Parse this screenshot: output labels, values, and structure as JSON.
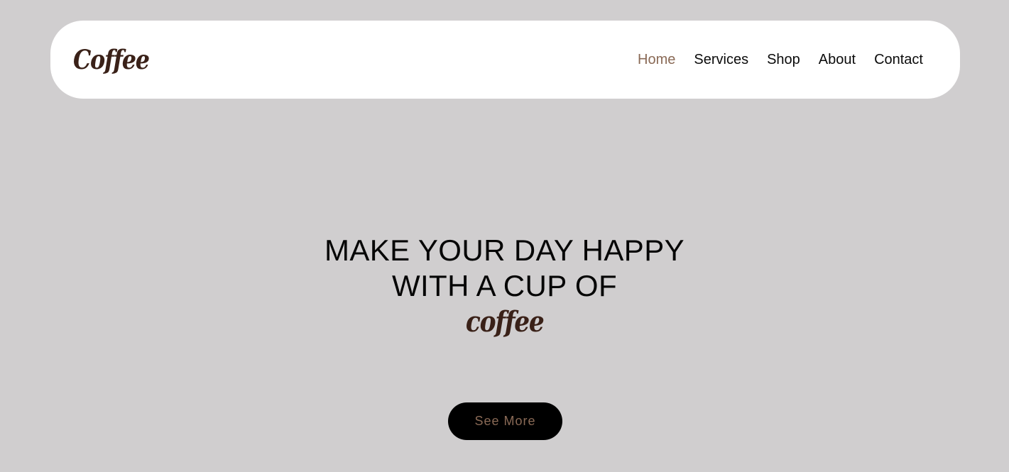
{
  "header": {
    "logo_text": "Coffee",
    "nav": [
      {
        "label": "Home",
        "active": true
      },
      {
        "label": "Services",
        "active": false
      },
      {
        "label": "Shop",
        "active": false
      },
      {
        "label": "About",
        "active": false
      },
      {
        "label": "Contact",
        "active": false
      }
    ]
  },
  "hero": {
    "line1": "MAKE YOUR DAY HAPPY",
    "line2": "WITH A CUP OF",
    "accent": "coffee",
    "button_label": "See More"
  },
  "colors": {
    "background": "#d0cecf",
    "navbar": "#ffffff",
    "brand_brown": "#3a2118",
    "accent_tan": "#8a6a56",
    "button": "#000000"
  }
}
